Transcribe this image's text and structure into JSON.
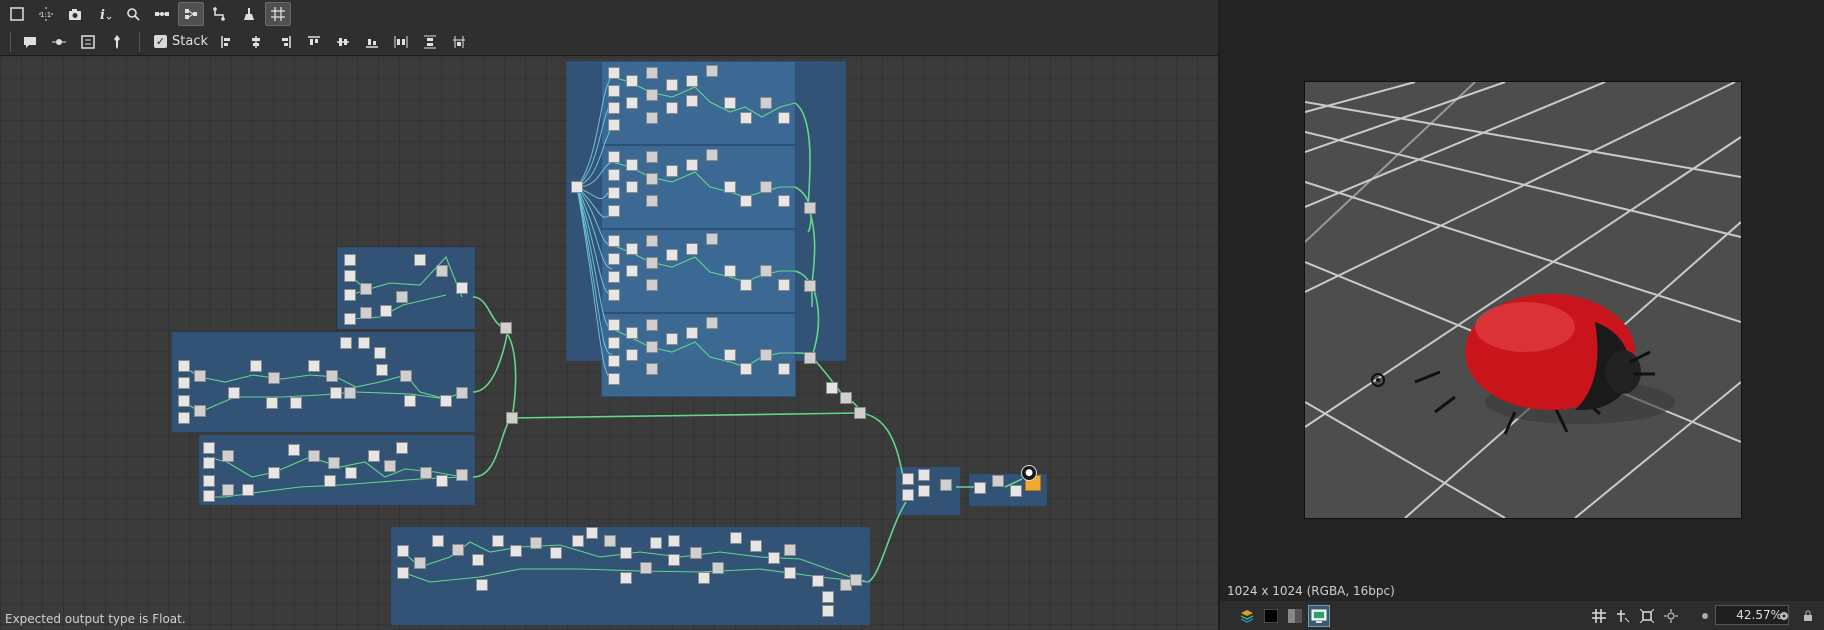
{
  "toolbar": {
    "row1": [
      {
        "name": "fit-view-icon",
        "glyph": "⛶"
      },
      {
        "name": "reset-zoom-icon",
        "glyph": "1:1"
      },
      {
        "name": "camera-icon",
        "glyph": "📷"
      },
      {
        "name": "info-icon",
        "glyph": "i"
      },
      {
        "name": "search-icon",
        "glyph": "🔍"
      },
      {
        "name": "link-nodes-icon",
        "glyph": "⇆"
      },
      {
        "name": "graph-layout-icon",
        "glyph": "⊞"
      },
      {
        "name": "connector-icon",
        "glyph": "⌐"
      },
      {
        "name": "clean-icon",
        "glyph": "⊥"
      },
      {
        "name": "grid-snap-icon",
        "glyph": "#"
      }
    ],
    "stack_label": "Stack"
  },
  "status": {
    "message": "Expected output type is Float."
  },
  "viewer": {
    "image_info": "1024 x 1024 (RGBA, 16bpc)",
    "zoom": "42.57%",
    "accent": "#3c5a6e"
  }
}
